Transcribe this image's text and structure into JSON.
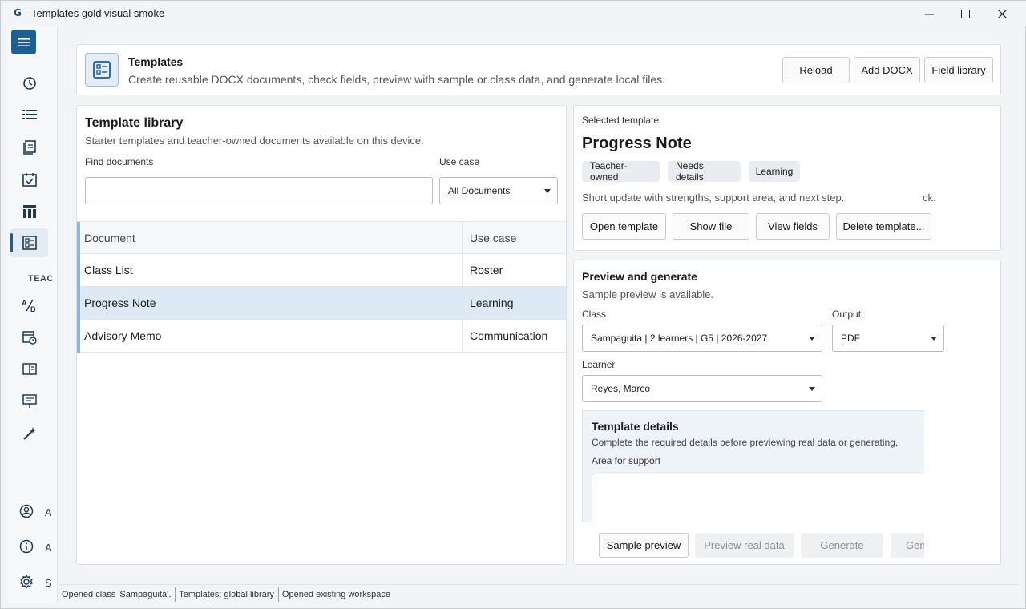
{
  "window": {
    "title": "Templates gold visual smoke",
    "logo_letter": "G",
    "minimize_glyph": "—",
    "maximize_glyph": "☐",
    "close_glyph": "✕"
  },
  "rail": {
    "section_label": "TEAC",
    "stubs": [
      "A",
      "A",
      "S"
    ]
  },
  "header": {
    "title": "Templates",
    "subtitle": "Create reusable DOCX documents, check fields, preview with sample or class data, and generate local files.",
    "buttons": [
      "Reload",
      "Add DOCX",
      "Field library"
    ]
  },
  "library": {
    "title": "Template library",
    "subtitle": "Starter templates and teacher-owned documents available on this device.",
    "find_label": "Find documents",
    "find_value": "",
    "usecase_label": "Use case",
    "usecase_value": "All Documents",
    "columns": [
      "Document",
      "Use case"
    ],
    "rows": [
      {
        "document": "Class List",
        "use_case": "Roster"
      },
      {
        "document": "Progress Note",
        "use_case": "Learning"
      },
      {
        "document": "Advisory Memo",
        "use_case": "Communication"
      }
    ]
  },
  "selected": {
    "eyebrow": "Selected template",
    "name": "Progress Note",
    "chips": [
      "Teacher-owned",
      "Needs details",
      "Learning"
    ],
    "description": "Short update with strengths, support area, and next step.",
    "description_tail": "ck.",
    "buttons": [
      "Open template",
      "Show file",
      "View fields",
      "Delete template..."
    ]
  },
  "preview": {
    "title": "Preview and generate",
    "status": "Sample preview is available.",
    "class_label": "Class",
    "class_value": "Sampaguita | 2 learners | G5 | 2026-2027",
    "output_label": "Output",
    "output_value": "PDF",
    "learner_label": "Learner",
    "learner_value": "Reyes, Marco",
    "details_title": "Template details",
    "details_subtitle": "Complete the required details before previewing real data or generating.",
    "area_label": "Area for support",
    "area_value": "",
    "actions": [
      "Sample preview",
      "Preview real data",
      "Generate",
      "Gene"
    ]
  },
  "status_bar": [
    "Opened class 'Sampaguita'.",
    "Templates: global library",
    "Opened existing workspace"
  ],
  "colors": {
    "accent": "#1e5f93",
    "selected_row": "#dde9f5",
    "row_accent": "#8fb6d8"
  }
}
